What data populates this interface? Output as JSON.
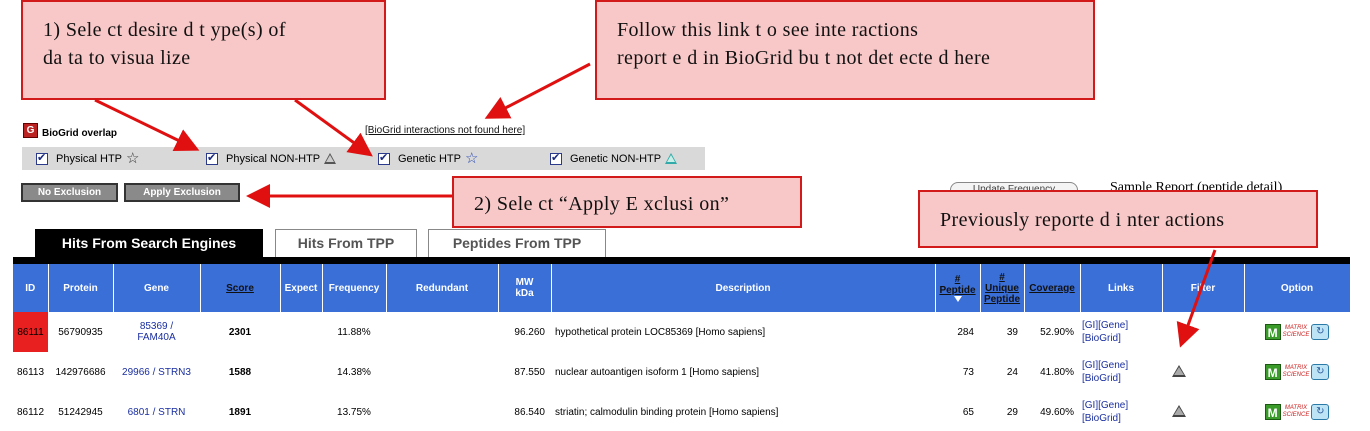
{
  "callouts": {
    "step1": [
      "1) Sele ct desire d t ype(s) of",
      "da ta to   visua lize"
    ],
    "follow": [
      "Follow  this  link t o  see  inte ractions",
      "report e d  in  BioGrid  bu t  not  det ecte d  here"
    ],
    "step2": "2)  Sele ct  “Apply E xclusi on”",
    "previous": "Previously  reporte d i nter actions"
  },
  "biogrid": {
    "logo": "G",
    "title": "BioGrid overlap",
    "link": "[BioGrid interactions not found here]",
    "filters": [
      {
        "label": "Physical HTP",
        "icon": "star-icon",
        "glyph": "☆"
      },
      {
        "label": "Physical NON-HTP",
        "icon": "gray-triangle-icon"
      },
      {
        "label": "Genetic HTP",
        "icon": "blue-star-icon",
        "glyph": "☆"
      },
      {
        "label": "Genetic NON-HTP",
        "icon": "teal-triangle-icon"
      }
    ]
  },
  "buttons": {
    "no_exclusion": "No Exclusion",
    "apply_exclusion": "Apply Exclusion",
    "update": "Update Frequency"
  },
  "sample_report": "Sample Report (peptide detail)",
  "tabs": [
    "Hits From Search Engines",
    "Hits From TPP",
    "Peptides From TPP"
  ],
  "table": {
    "headers": {
      "id": "ID",
      "protein": "Protein",
      "gene": "Gene",
      "score": "Score",
      "expect": "Expect",
      "frequency": "Frequency",
      "redundant": "Redundant",
      "mw": "MW",
      "mw_unit": "kDa",
      "description": "Description",
      "peptide_hash": "#",
      "peptide": "Peptide",
      "unique_hash": "#",
      "unique": "Unique",
      "unique_peptide": "Peptide",
      "coverage": "Coverage",
      "links": "Links",
      "filter": "Filter",
      "option": "Option"
    },
    "rows": [
      {
        "id": "86111",
        "protein": "56790935",
        "gene1": "85369 /",
        "gene2": "FAM40A",
        "score": "2301",
        "expect": "",
        "frequency": "11.88%",
        "redundant": "",
        "mw": "96.260",
        "description": "hypothetical protein LOC85369 [Homo sapiens]",
        "peptide": "284",
        "unique": "39",
        "coverage": "52.90%",
        "link1": "[GI][Gene]",
        "link2": "[BioGrid]",
        "filter": false
      },
      {
        "id": "86113",
        "protein": "142976686",
        "gene1": "29966 / STRN3",
        "gene2": "",
        "score": "1588",
        "expect": "",
        "frequency": "14.38%",
        "redundant": "",
        "mw": "87.550",
        "description": "nuclear autoantigen isoform 1 [Homo sapiens]",
        "peptide": "73",
        "unique": "24",
        "coverage": "41.80%",
        "link1": "[GI][Gene]",
        "link2": "[BioGrid]",
        "filter": true
      },
      {
        "id": "86112",
        "protein": "51242945",
        "gene1": "6801 / STRN",
        "gene2": "",
        "score": "1891",
        "expect": "",
        "frequency": "13.75%",
        "redundant": "",
        "mw": "86.540",
        "description": "striatin; calmodulin binding protein [Homo sapiens]",
        "peptide": "65",
        "unique": "29",
        "coverage": "49.60%",
        "link1": "[GI][Gene]",
        "link2": "[BioGrid]",
        "filter": true
      }
    ],
    "option_labels": {
      "m": "M",
      "matrix1": "MATRIX",
      "matrix2": "SCIENCE"
    }
  },
  "colors": {
    "callout_fill": "#f8c8c8",
    "callout_border": "#d21a1a",
    "header_blue": "#3a6fd8",
    "id_highlight": "#e82020"
  }
}
